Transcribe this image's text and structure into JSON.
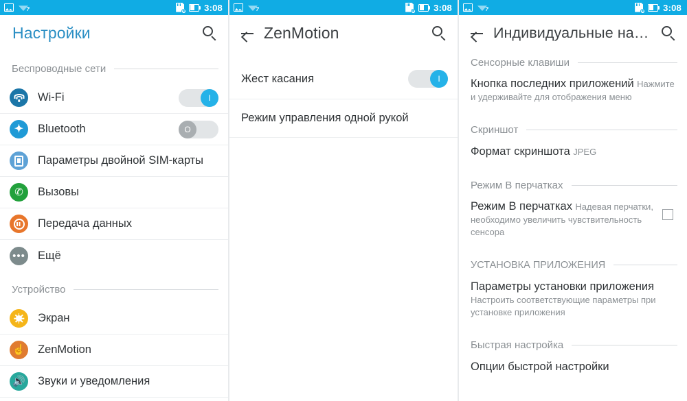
{
  "theme": {
    "statusbar_bg": "#10ACE4",
    "title_blue": "#2b8fc4",
    "title_dark": "#3b3f42",
    "toggle_on": "#25B2E8",
    "toggle_off": "#a9aeb1"
  },
  "statusbar": {
    "time": "3:08",
    "left_icons": [
      "screenshot-image-icon",
      "wifi-question-icon"
    ],
    "right_icons": [
      "sd-card-removed-icon",
      "battery-icon"
    ]
  },
  "screens": [
    {
      "id": "settings",
      "appbar": {
        "title": "Настройки",
        "title_style": "blue",
        "has_back": false,
        "search_icon": "search-icon"
      },
      "sections": [
        {
          "header": "Беспроводные сети",
          "items": [
            {
              "label": "Wi-Fi",
              "icon": "wifi-icon",
              "icon_color": "#1b76a8",
              "control": "toggle",
              "state": "on",
              "on_label": "I"
            },
            {
              "label": "Bluetooth",
              "icon": "bluetooth-icon",
              "icon_color": "#1f9ad6",
              "control": "toggle",
              "state": "off",
              "off_label": "O"
            },
            {
              "label": "Параметры двойной SIM-карты",
              "icon": "sim-card-icon",
              "icon_color": "#5ea2d6",
              "control": "none"
            },
            {
              "label": "Вызовы",
              "icon": "phone-call-icon",
              "icon_color": "#22a13c",
              "control": "none"
            },
            {
              "label": "Передача данных",
              "icon": "data-usage-icon",
              "icon_color": "#e8762b",
              "control": "none"
            },
            {
              "label": "Ещё",
              "icon": "more-dots-icon",
              "icon_color": "#7d8b8c",
              "control": "none"
            }
          ]
        },
        {
          "header": "Устройство",
          "items": [
            {
              "label": "Экран",
              "icon": "brightness-sun-icon",
              "icon_color": "#f5b519",
              "control": "none"
            },
            {
              "label": "ZenMotion",
              "icon": "hand-gesture-icon",
              "icon_color": "#e07b30",
              "control": "none"
            },
            {
              "label": "Звуки и уведомления",
              "icon": "sound-icon",
              "icon_color": "#27a89c",
              "control": "none"
            }
          ]
        }
      ]
    },
    {
      "id": "zenmotion",
      "appbar": {
        "title": "ZenMotion",
        "title_style": "dark",
        "has_back": true,
        "back_icon": "back-arrow-icon",
        "search_icon": "search-icon"
      },
      "rows": [
        {
          "title": "Жест касания",
          "sub": "",
          "control": "toggle",
          "state": "on",
          "on_label": "I"
        },
        {
          "title": "Режим управления одной рукой",
          "sub": "",
          "control": "none"
        }
      ]
    },
    {
      "id": "individual-settings",
      "appbar": {
        "title": "Индивидуальные на…",
        "title_style": "dark",
        "has_back": true,
        "back_icon": "back-arrow-icon",
        "search_icon": "search-icon"
      },
      "sections": [
        {
          "header": "Сенсорные клавиши",
          "rows": [
            {
              "title": "Кнопка последних приложений",
              "sub": "Нажмите и удерживайте для отображения меню",
              "control": "none"
            }
          ]
        },
        {
          "header": "Скриншот",
          "rows": [
            {
              "title": "Формат скриншота",
              "sub": "JPEG",
              "control": "none"
            }
          ]
        },
        {
          "header": "Режим В перчатках",
          "rows": [
            {
              "title": "Режим В перчатках",
              "sub": "Надевая перчатки, необходимо увеличить чувствительность сенсора",
              "control": "checkbox",
              "state": "unchecked"
            }
          ]
        },
        {
          "header": "УСТАНОВКА ПРИЛОЖЕНИЯ",
          "rows": [
            {
              "title": "Параметры установки приложения",
              "sub": "Настроить соответствующие параметры при установке приложения",
              "control": "none"
            }
          ]
        },
        {
          "header": "Быстрая настройка",
          "rows": [
            {
              "title": "Опции быстрой настройки",
              "sub": "",
              "control": "none"
            }
          ]
        }
      ]
    }
  ]
}
